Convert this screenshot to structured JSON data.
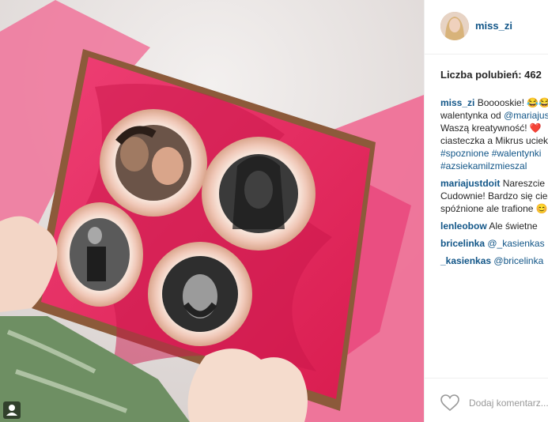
{
  "post": {
    "username": "miss_zi",
    "likes_text": "Liczba polubień: 462"
  },
  "comments": [
    {
      "author": "miss_zi",
      "lines": [
        {
          "text": "Booooskie! 😂😂"
        },
        {
          "text": "walentynka od ",
          "tag": "@mariajustdoit"
        },
        {
          "text": "Waszą kreatywność! ❤️"
        },
        {
          "text": "ciasteczka a Mikrus uciekł"
        },
        {
          "tag": "#spoznione #walentynki"
        },
        {
          "tag": "#azsiekamilzmieszal"
        }
      ],
      "first_text": " Booooskie! 😂😂"
    },
    {
      "author": "mariajustdoit",
      "first_text": " Nareszcie",
      "lines": [
        {
          "text": "Cudownie! Bardzo się cieszę"
        },
        {
          "text": "spóźnione ale trafione 😊"
        }
      ]
    },
    {
      "author": "lenleobow",
      "first_text": " Ale świetne"
    },
    {
      "author": "bricelinka",
      "first_text": " ",
      "first_tag": "@_kasienkas"
    },
    {
      "author": "_kasienkas",
      "first_text": " ",
      "first_tag": "@bricelinka"
    }
  ],
  "footer": {
    "add_comment_placeholder": "Dodaj komentarz..."
  },
  "icons": {
    "like": "heart-icon",
    "user": "user-icon"
  },
  "colors": {
    "link": "#125688",
    "text": "#262626",
    "muted": "#999999",
    "tissue_pink": "#e8255a",
    "icing": "#f3c9b5"
  }
}
